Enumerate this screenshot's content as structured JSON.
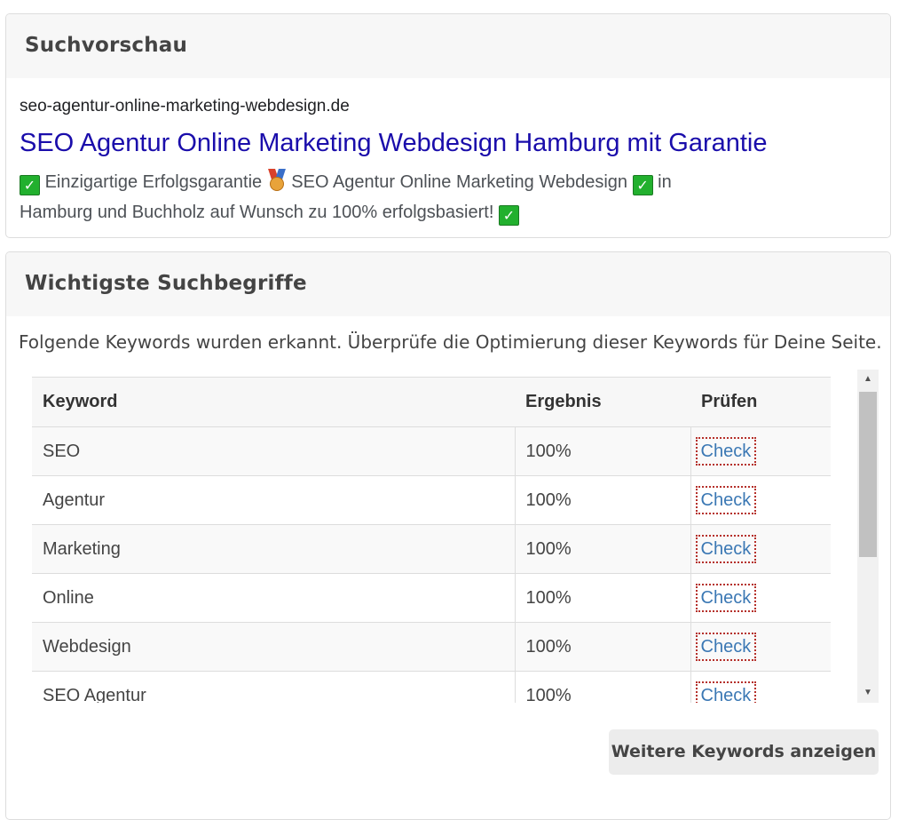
{
  "preview": {
    "heading": "Suchvorschau",
    "url": "seo-agentur-online-marketing-webdesign.de",
    "title": "SEO Agentur Online Marketing Webdesign Hamburg mit Garantie",
    "desc_parts": [
      "Einzigartige Erfolgsgarantie",
      "SEO Agentur Online Marketing Webdesign",
      "in",
      "Hamburg und Buchholz auf Wunsch zu 100% erfolgsbasiert!"
    ],
    "icons": [
      "check-mark-icon",
      "medal-icon"
    ],
    "check_glyph": "✓"
  },
  "keywords": {
    "heading": "Wichtigste Suchbegriffe",
    "intro": "Folgende Keywords wurden erkannt. Überprüfe die Optimierung dieser Keywords für Deine Seite.",
    "columns": [
      "Keyword",
      "Ergebnis",
      "Prüfen"
    ],
    "rows": [
      {
        "keyword": "SEO",
        "result": "100%",
        "action": "Check"
      },
      {
        "keyword": "Agentur",
        "result": "100%",
        "action": "Check"
      },
      {
        "keyword": "Marketing",
        "result": "100%",
        "action": "Check"
      },
      {
        "keyword": "Online",
        "result": "100%",
        "action": "Check"
      },
      {
        "keyword": "Webdesign",
        "result": "100%",
        "action": "Check"
      },
      {
        "keyword": "SEO Agentur",
        "result": "100%",
        "action": "Check"
      }
    ],
    "more_button": "Weitere Keywords anzeigen",
    "scroll_up_glyph": "▲",
    "scroll_down_glyph": "▼"
  },
  "colors": {
    "serp_title": "#1a0dab",
    "check_link": "#3b78b4",
    "check_badge": "#22b02e"
  }
}
